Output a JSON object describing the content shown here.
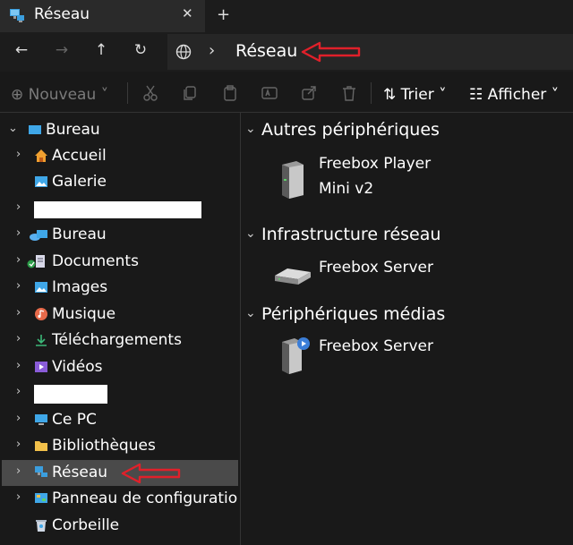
{
  "window": {
    "tab_title": "Réseau",
    "tab_close": "✕",
    "new_tab": "+"
  },
  "nav": {
    "back": "←",
    "forward": "→",
    "up": "↑",
    "refresh": "↻",
    "crumb_sep": "›",
    "crumb": "Réseau"
  },
  "commands": {
    "new_label": "⊕ Nouveau ˅",
    "sort_label": "⇅ Trier ˅",
    "view_label": "☷ Afficher ˅"
  },
  "sidebar": {
    "items": [
      {
        "label": "Bureau",
        "chev": "⌄"
      },
      {
        "label": "Accueil",
        "chev": "›"
      },
      {
        "label": "Galerie",
        "chev": ""
      },
      {
        "label": "",
        "chev": "›"
      },
      {
        "label": "Bureau",
        "chev": "›"
      },
      {
        "label": "Documents",
        "chev": "›"
      },
      {
        "label": "Images",
        "chev": "›"
      },
      {
        "label": "Musique",
        "chev": "›"
      },
      {
        "label": "Téléchargements",
        "chev": "›"
      },
      {
        "label": "Vidéos",
        "chev": "›"
      },
      {
        "label": "",
        "chev": "›"
      },
      {
        "label": "Ce PC",
        "chev": "›"
      },
      {
        "label": "Bibliothèques",
        "chev": "›"
      },
      {
        "label": "Réseau",
        "chev": "›"
      },
      {
        "label": "Panneau de configuratio",
        "chev": "›"
      },
      {
        "label": "Corbeille",
        "chev": ""
      }
    ]
  },
  "content": {
    "groups": [
      {
        "title": "Autres périphériques",
        "chev": "⌄",
        "devices": [
          {
            "line1": "Freebox Player",
            "line2": "Mini v2"
          }
        ]
      },
      {
        "title": "Infrastructure réseau",
        "chev": "⌄",
        "devices": [
          {
            "line1": "Freebox Server",
            "line2": ""
          }
        ]
      },
      {
        "title": "Périphériques médias",
        "chev": "⌄",
        "devices": [
          {
            "line1": "Freebox Server",
            "line2": ""
          }
        ]
      }
    ]
  },
  "colors": {
    "annotation_arrow": "#e0202a",
    "selected_bg": "#4a4a4a"
  }
}
